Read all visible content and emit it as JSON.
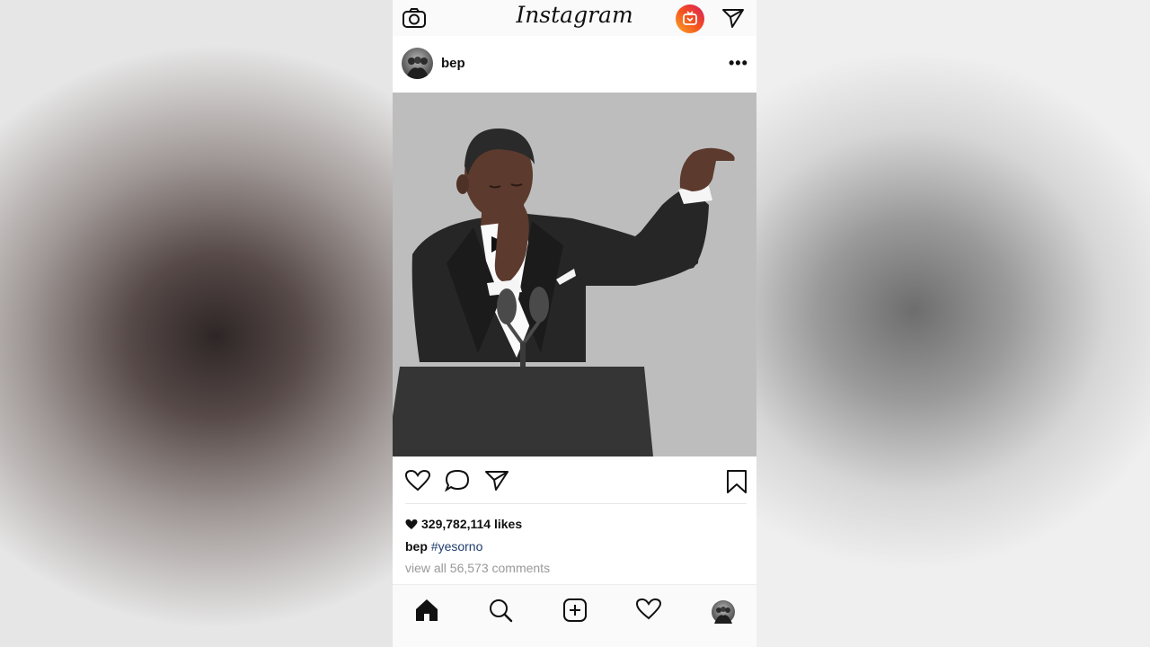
{
  "app": {
    "logo": "Instagram"
  },
  "post": {
    "username": "bep",
    "more_label": "•••",
    "likes": "329,782,114 likes",
    "caption_user": "bep",
    "caption_text": "#yesorno",
    "view_comments": "view all 56,573 comments"
  },
  "colors": {
    "hashtag": "#1f3c6e",
    "igtv_gradient": [
      "#f9a825",
      "#f4511e",
      "#d81b60"
    ],
    "image_bg": "#bdbdbd"
  },
  "icons": {
    "top": [
      "camera-icon",
      "igtv-icon",
      "direct-message-icon"
    ],
    "actions": [
      "heart-icon",
      "comment-icon",
      "share-icon",
      "bookmark-icon"
    ],
    "bottom_nav": [
      "home-icon",
      "search-icon",
      "new-post-icon",
      "activity-heart-icon",
      "profile-avatar"
    ]
  }
}
